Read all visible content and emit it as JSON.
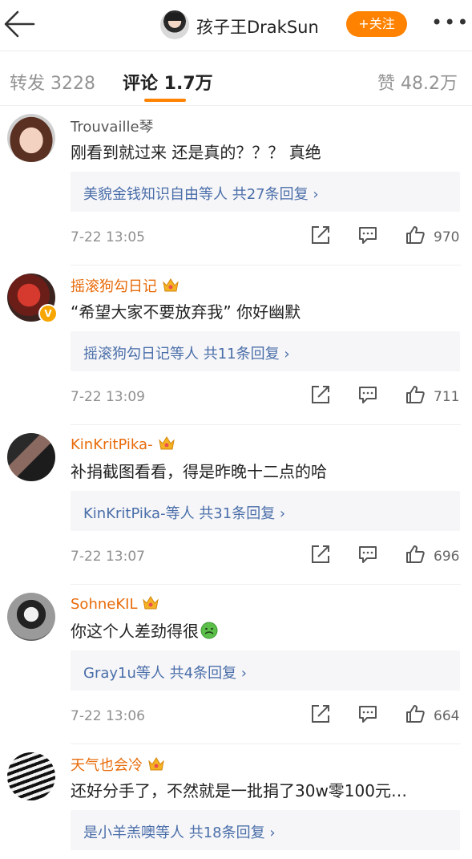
{
  "header": {
    "title": "孩子王DrakSun",
    "follow_label": "+关注",
    "more_label": "•••"
  },
  "tabs": {
    "repost": "转发 3228",
    "comment": "评论 1.7万",
    "like": "赞 48.2万"
  },
  "colors": {
    "accent": "#ff8200",
    "link": "#4a6ea9",
    "vip_name": "#e86b0a"
  },
  "comments": [
    {
      "user": "Trouvaille琴",
      "text": "刚看到就过来  还是真的？？？ 真绝",
      "replies": "美貌金钱知识自由等人  共27条回复 ›",
      "time": "7-22 13:05",
      "likes": "970"
    },
    {
      "user": "摇滚狗勾日记",
      "text": "“希望大家不要放弃我” 你好幽默",
      "replies": "摇滚狗勾日记等人  共11条回复 ›",
      "time": "7-22 13:09",
      "likes": "711"
    },
    {
      "user": "KinKritPika-",
      "text": "补捐截图看看，得是昨晚十二点的哈",
      "replies": "KinKritPika-等人  共31条回复 ›",
      "time": "7-22 13:07",
      "likes": "696"
    },
    {
      "user": "SohneKIL",
      "text": "你这个人差劲得很",
      "replies": "Gray1u等人  共4条回复 ›",
      "time": "7-22 13:06",
      "likes": "664"
    },
    {
      "user": "天气也会冷",
      "text": "还好分手了，不然就是一批捐了30w零100元…",
      "replies": "是小羊羔噢等人  共18条回复 ›",
      "time": "",
      "likes": ""
    }
  ]
}
